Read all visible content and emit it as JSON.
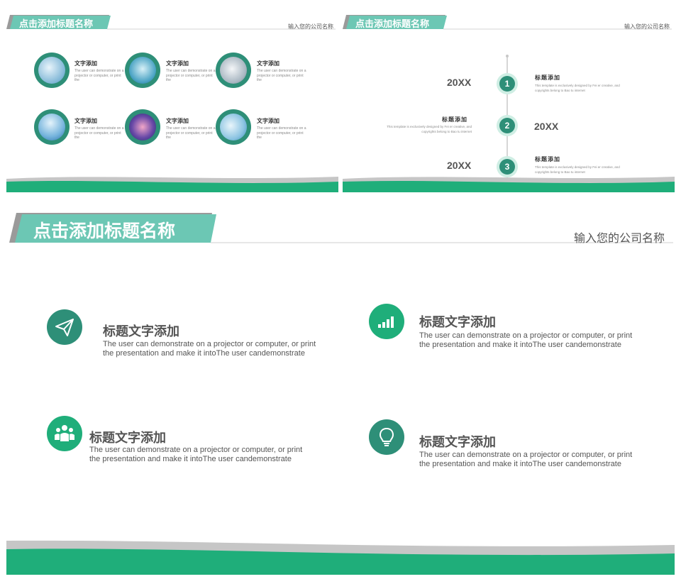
{
  "colors": {
    "teal": "#2e8f78",
    "green": "#1fae7a",
    "mint": "#6cc7b4",
    "gray": "#bdbdbd"
  },
  "slide1": {
    "title": "点击添加标题名称",
    "company": "输入您的公司名称",
    "items": [
      {
        "title": "文字添加",
        "desc": "The user can demonstrate on a projector or computer, or print the",
        "icon": "lab-photo-icon"
      },
      {
        "title": "文字添加",
        "desc": "The user can demonstrate on a projector or computer, or print the",
        "icon": "lab-photo-icon"
      },
      {
        "title": "文字添加",
        "desc": "The user can demonstrate on a projector or computer, or print the",
        "icon": "lab-photo-icon"
      },
      {
        "title": "文字添加",
        "desc": "The user can demonstrate on a projector or computer, or print the",
        "icon": "lab-photo-icon"
      },
      {
        "title": "文字添加",
        "desc": "The user can demonstrate on a projector or computer, or print the",
        "icon": "lab-photo-icon"
      },
      {
        "title": "文字添加",
        "desc": "The user can demonstrate on a projector or computer, or print the",
        "icon": "lab-photo-icon"
      }
    ]
  },
  "slide2": {
    "title": "点击添加标题名称",
    "company": "输入您的公司名称",
    "timeline": [
      {
        "num": "1",
        "year": "20XX",
        "title": "标题添加",
        "desc": "This template is exclusively designed by Fei er creative, and copyrights belong to Bao tu internet"
      },
      {
        "num": "2",
        "year": "20XX",
        "title": "标题添加",
        "desc": "This template is exclusively designed by Fei er creative, and copyrights belong to Bao tu internet"
      },
      {
        "num": "3",
        "year": "20XX",
        "title": "标题添加",
        "desc": "This template is exclusively designed by Fei er creative, and copyrights belong to Bao tu internet"
      }
    ]
  },
  "slide3": {
    "title": "点击添加标题名称",
    "company": "输入您的公司名称",
    "features": [
      {
        "title": "标题文字添加",
        "desc": "The user can demonstrate on a projector or computer, or print the presentation and make it intoThe user candemonstrate",
        "icon": "paper-plane-icon"
      },
      {
        "title": "标题文字添加",
        "desc": "The user can demonstrate on a projector or computer, or print the presentation and make it intoThe user candemonstrate",
        "icon": "bar-chart-icon"
      },
      {
        "title": "标题文字添加",
        "desc": "The user can demonstrate on a projector or computer, or print the presentation and make it intoThe user candemonstrate",
        "icon": "team-icon"
      },
      {
        "title": "标题文字添加",
        "desc": "The user can demonstrate on a projector or computer, or print the presentation and make it intoThe user candemonstrate",
        "icon": "lightbulb-icon"
      }
    ]
  }
}
